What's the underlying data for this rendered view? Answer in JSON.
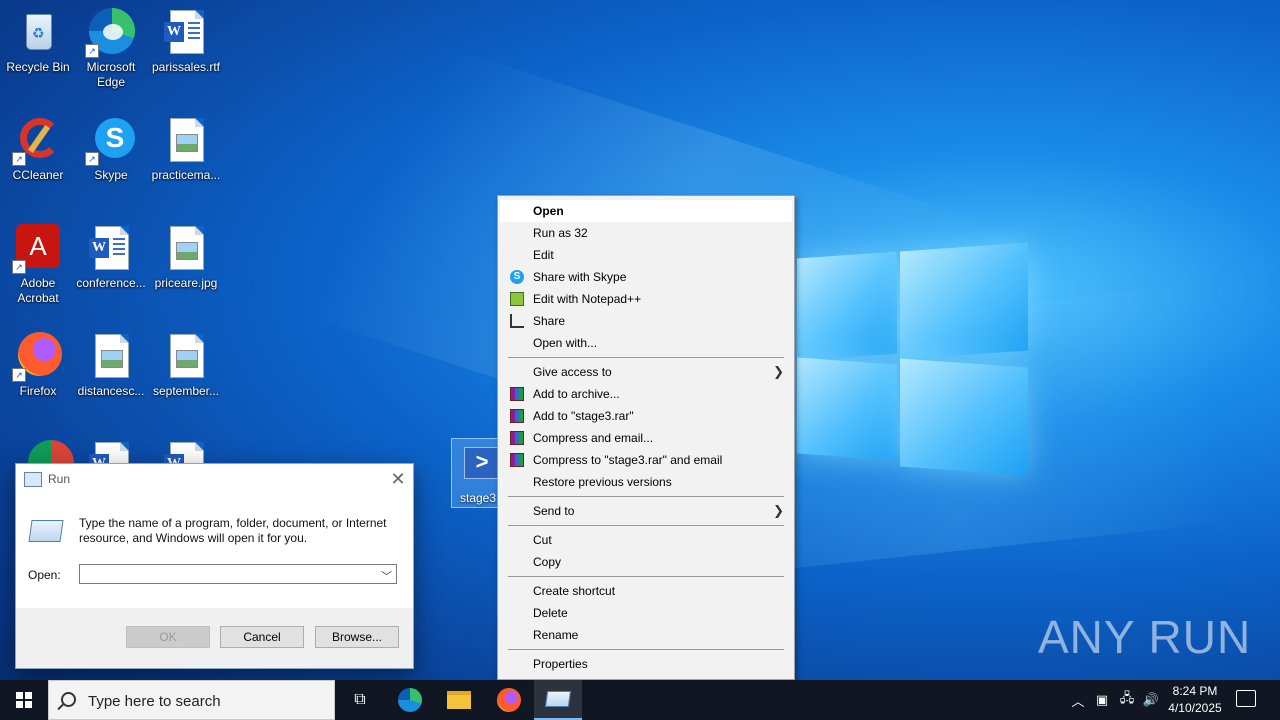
{
  "desktop": {
    "icons": [
      {
        "label": "Recycle Bin"
      },
      {
        "label": "Microsoft Edge"
      },
      {
        "label": "parissales.rtf"
      },
      {
        "label": "CCleaner"
      },
      {
        "label": "Skype"
      },
      {
        "label": "practicema..."
      },
      {
        "label": "Adobe Acrobat"
      },
      {
        "label": "conference..."
      },
      {
        "label": "priceare.jpg"
      },
      {
        "label": "Firefox"
      },
      {
        "label": "distancesc..."
      },
      {
        "label": "september..."
      }
    ],
    "selected_icon_label": "stage3."
  },
  "run_dialog": {
    "title": "Run",
    "description": "Type the name of a program, folder, document, or Internet resource, and Windows will open it for you.",
    "open_label": "Open:",
    "open_value": "",
    "buttons": {
      "ok": "OK",
      "cancel": "Cancel",
      "browse": "Browse..."
    }
  },
  "context_menu": {
    "items": [
      {
        "label": "Open"
      },
      {
        "label": "Run as 32"
      },
      {
        "label": "Edit"
      },
      {
        "label": "Share with Skype",
        "icon": "skype-icon"
      },
      {
        "label": "Edit with Notepad++",
        "icon": "notepadpp-icon"
      },
      {
        "label": "Share",
        "icon": "share-icon"
      },
      {
        "label": "Open with..."
      },
      {
        "label": "Give access to"
      },
      {
        "label": "Add to archive...",
        "icon": "winrar-icon"
      },
      {
        "label": "Add to \"stage3.rar\"",
        "icon": "winrar-icon"
      },
      {
        "label": "Compress and email...",
        "icon": "winrar-icon"
      },
      {
        "label": "Compress to \"stage3.rar\" and email",
        "icon": "winrar-icon"
      },
      {
        "label": "Restore previous versions"
      },
      {
        "label": "Send to"
      },
      {
        "label": "Cut"
      },
      {
        "label": "Copy"
      },
      {
        "label": "Create shortcut"
      },
      {
        "label": "Delete"
      },
      {
        "label": "Rename"
      },
      {
        "label": "Properties"
      }
    ]
  },
  "watermark": "ANY RUN",
  "taskbar": {
    "search_placeholder": "Type here to search",
    "clock_time": "8:24 PM",
    "clock_date": "4/10/2025"
  }
}
